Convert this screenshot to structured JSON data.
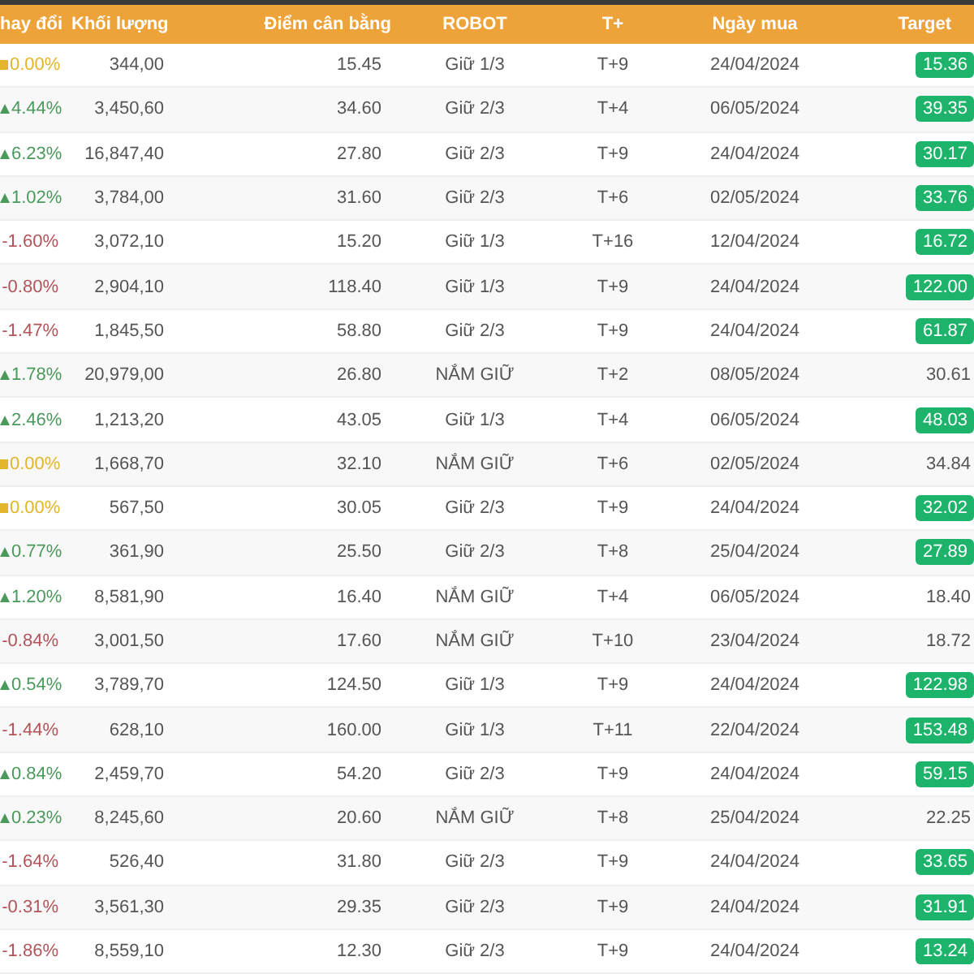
{
  "table": {
    "columns": [
      "hay đổi",
      "Khối lượng",
      "Điểm cân bằng",
      "ROBOT",
      "T+",
      "Ngày mua",
      "Target"
    ],
    "rows": [
      {
        "kind": "flat",
        "change": "0.00%",
        "volume": "344,00",
        "balance": "15.45",
        "robot": "Giữ 1/3",
        "t": "T+9",
        "date": "24/04/2024",
        "target": "15.36",
        "hit": true
      },
      {
        "kind": "up",
        "change": "4.44%",
        "volume": "3,450,60",
        "balance": "34.60",
        "robot": "Giữ 2/3",
        "t": "T+4",
        "date": "06/05/2024",
        "target": "39.35",
        "hit": true
      },
      {
        "kind": "up",
        "change": "6.23%",
        "volume": "16,847,40",
        "balance": "27.80",
        "robot": "Giữ 2/3",
        "t": "T+9",
        "date": "24/04/2024",
        "target": "30.17",
        "hit": true
      },
      {
        "kind": "up",
        "change": "1.02%",
        "volume": "3,784,00",
        "balance": "31.60",
        "robot": "Giữ 2/3",
        "t": "T+6",
        "date": "02/05/2024",
        "target": "33.76",
        "hit": true
      },
      {
        "kind": "down",
        "change": "-1.60%",
        "volume": "3,072,10",
        "balance": "15.20",
        "robot": "Giữ 1/3",
        "t": "T+16",
        "date": "12/04/2024",
        "target": "16.72",
        "hit": true
      },
      {
        "kind": "down",
        "change": "-0.80%",
        "volume": "2,904,10",
        "balance": "118.40",
        "robot": "Giữ 1/3",
        "t": "T+9",
        "date": "24/04/2024",
        "target": "122.00",
        "hit": true
      },
      {
        "kind": "down",
        "change": "-1.47%",
        "volume": "1,845,50",
        "balance": "58.80",
        "robot": "Giữ 2/3",
        "t": "T+9",
        "date": "24/04/2024",
        "target": "61.87",
        "hit": true
      },
      {
        "kind": "up",
        "change": "1.78%",
        "volume": "20,979,00",
        "balance": "26.80",
        "robot": "NẮM GIỮ",
        "t": "T+2",
        "date": "08/05/2024",
        "target": "30.61",
        "hit": false
      },
      {
        "kind": "up",
        "change": "2.46%",
        "volume": "1,213,20",
        "balance": "43.05",
        "robot": "Giữ 1/3",
        "t": "T+4",
        "date": "06/05/2024",
        "target": "48.03",
        "hit": true
      },
      {
        "kind": "flat",
        "change": "0.00%",
        "volume": "1,668,70",
        "balance": "32.10",
        "robot": "NẮM GIỮ",
        "t": "T+6",
        "date": "02/05/2024",
        "target": "34.84",
        "hit": false
      },
      {
        "kind": "flat",
        "change": "0.00%",
        "volume": "567,50",
        "balance": "30.05",
        "robot": "Giữ 2/3",
        "t": "T+9",
        "date": "24/04/2024",
        "target": "32.02",
        "hit": true
      },
      {
        "kind": "up",
        "change": "0.77%",
        "volume": "361,90",
        "balance": "25.50",
        "robot": "Giữ 2/3",
        "t": "T+8",
        "date": "25/04/2024",
        "target": "27.89",
        "hit": true
      },
      {
        "kind": "up",
        "change": "1.20%",
        "volume": "8,581,90",
        "balance": "16.40",
        "robot": "NẮM GIỮ",
        "t": "T+4",
        "date": "06/05/2024",
        "target": "18.40",
        "hit": false
      },
      {
        "kind": "down",
        "change": "-0.84%",
        "volume": "3,001,50",
        "balance": "17.60",
        "robot": "NẮM GIỮ",
        "t": "T+10",
        "date": "23/04/2024",
        "target": "18.72",
        "hit": false
      },
      {
        "kind": "up",
        "change": "0.54%",
        "volume": "3,789,70",
        "balance": "124.50",
        "robot": "Giữ 1/3",
        "t": "T+9",
        "date": "24/04/2024",
        "target": "122.98",
        "hit": true
      },
      {
        "kind": "down",
        "change": "-1.44%",
        "volume": "628,10",
        "balance": "160.00",
        "robot": "Giữ 1/3",
        "t": "T+11",
        "date": "22/04/2024",
        "target": "153.48",
        "hit": true
      },
      {
        "kind": "up",
        "change": "0.84%",
        "volume": "2,459,70",
        "balance": "54.20",
        "robot": "Giữ 2/3",
        "t": "T+9",
        "date": "24/04/2024",
        "target": "59.15",
        "hit": true
      },
      {
        "kind": "up",
        "change": "0.23%",
        "volume": "8,245,60",
        "balance": "20.60",
        "robot": "NẮM GIỮ",
        "t": "T+8",
        "date": "25/04/2024",
        "target": "22.25",
        "hit": false
      },
      {
        "kind": "down",
        "change": "-1.64%",
        "volume": "526,40",
        "balance": "31.80",
        "robot": "Giữ 2/3",
        "t": "T+9",
        "date": "24/04/2024",
        "target": "33.65",
        "hit": true
      },
      {
        "kind": "down",
        "change": "-0.31%",
        "volume": "3,561,30",
        "balance": "29.35",
        "robot": "Giữ 2/3",
        "t": "T+9",
        "date": "24/04/2024",
        "target": "31.91",
        "hit": true
      },
      {
        "kind": "down",
        "change": "-1.86%",
        "volume": "8,559,10",
        "balance": "12.30",
        "robot": "Giữ 2/3",
        "t": "T+9",
        "date": "24/04/2024",
        "target": "13.24",
        "hit": true
      }
    ]
  }
}
